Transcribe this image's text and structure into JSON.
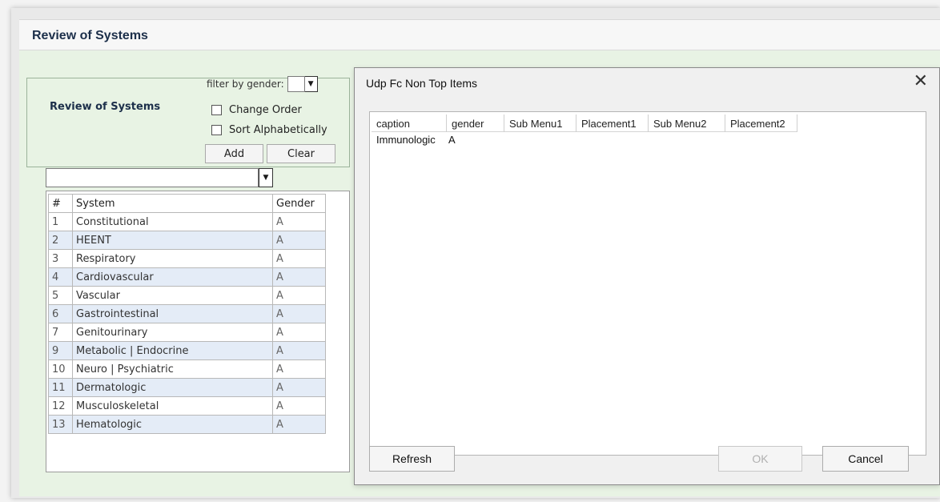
{
  "main": {
    "title": "Review of Systems",
    "filter_label": "filter by gender:",
    "panel_heading": "Review of Systems",
    "change_order_label": "Change Order",
    "sort_alpha_label": "Sort Alphabetically",
    "add_label": "Add",
    "clear_label": "Clear",
    "table": {
      "headers": [
        "#",
        "System",
        "Gender"
      ],
      "rows": [
        {
          "num": "1",
          "system": "Constitutional",
          "gender": "A"
        },
        {
          "num": "2",
          "system": "HEENT",
          "gender": "A"
        },
        {
          "num": "3",
          "system": "Respiratory",
          "gender": "A"
        },
        {
          "num": "4",
          "system": "Cardiovascular",
          "gender": "A"
        },
        {
          "num": "5",
          "system": "Vascular",
          "gender": "A"
        },
        {
          "num": "6",
          "system": "Gastrointestinal",
          "gender": "A"
        },
        {
          "num": "7",
          "system": "Genitourinary",
          "gender": "A"
        },
        {
          "num": "9",
          "system": "Metabolic | Endocrine",
          "gender": "A"
        },
        {
          "num": "10",
          "system": "Neuro | Psychiatric",
          "gender": "A"
        },
        {
          "num": "11",
          "system": "Dermatologic",
          "gender": "A"
        },
        {
          "num": "12",
          "system": "Musculoskeletal",
          "gender": "A"
        },
        {
          "num": "13",
          "system": "Hematologic",
          "gender": "A"
        }
      ]
    }
  },
  "dialog": {
    "title": "Udp Fc Non Top Items",
    "close_icon": "close-icon",
    "columns": [
      "caption",
      "gender",
      "Sub Menu1",
      "Placement1",
      "Sub Menu2",
      "Placement2"
    ],
    "rows": [
      {
        "caption": "Immunologic",
        "gender": "A"
      }
    ],
    "refresh_label": "Refresh",
    "ok_label": "OK",
    "cancel_label": "Cancel"
  }
}
